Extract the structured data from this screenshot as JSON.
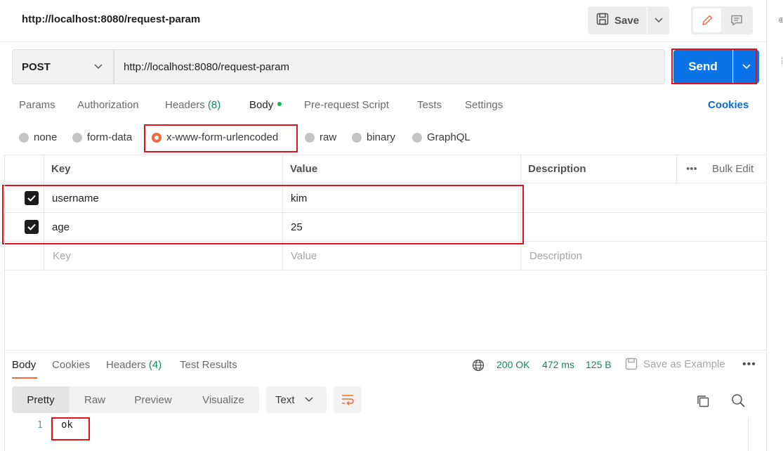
{
  "header": {
    "title": "http://localhost:8080/request-param",
    "save_label": "Save"
  },
  "request": {
    "method": "POST",
    "url": "http://localhost:8080/request-param",
    "send_label": "Send"
  },
  "req_tabs": {
    "params": "Params",
    "authorization": "Authorization",
    "headers": "Headers",
    "headers_count": "(8)",
    "body": "Body",
    "pre_request": "Pre-request Script",
    "tests": "Tests",
    "settings": "Settings",
    "cookies": "Cookies"
  },
  "body_types": {
    "none": "none",
    "form_data": "form-data",
    "urlencoded": "x-www-form-urlencoded",
    "raw": "raw",
    "binary": "binary",
    "graphql": "GraphQL",
    "selected": "x-www-form-urlencoded"
  },
  "table": {
    "headers": {
      "key": "Key",
      "value": "Value",
      "description": "Description",
      "bulk_edit": "Bulk Edit"
    },
    "rows": [
      {
        "key": "username",
        "value": "kim",
        "checked": true
      },
      {
        "key": "age",
        "value": "25",
        "checked": true
      }
    ],
    "placeholder": {
      "key": "Key",
      "value": "Value",
      "description": "Description"
    }
  },
  "response": {
    "tabs": {
      "body": "Body",
      "cookies": "Cookies",
      "headers": "Headers",
      "headers_count": "(4)",
      "test_results": "Test Results"
    },
    "status": "200 OK",
    "time": "472 ms",
    "size": "125 B",
    "save_example": "Save as Example",
    "views": {
      "pretty": "Pretty",
      "raw": "Raw",
      "preview": "Preview",
      "visualize": "Visualize"
    },
    "format": "Text",
    "lines": [
      {
        "no": "1",
        "text": "ok"
      }
    ]
  },
  "colors": {
    "accent": "#0b73e8",
    "success": "#0f8a5f",
    "annotation": "#e0121b",
    "active_tab": "#f26b3a"
  }
}
